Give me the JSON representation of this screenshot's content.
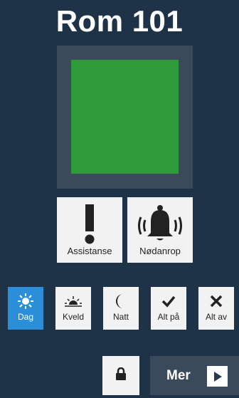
{
  "room": {
    "title": "Rom 101"
  },
  "status": {
    "color": "#2f9a3a"
  },
  "actions": {
    "assistance_label": "Assistanse",
    "assistance_icon": "exclamation-icon",
    "emergency_label": "Nødanrop",
    "emergency_icon": "alarm-bell-icon"
  },
  "modes": [
    {
      "label": "Dag",
      "icon": "sun-icon",
      "active": true
    },
    {
      "label": "Kveld",
      "icon": "sunset-icon",
      "active": false
    },
    {
      "label": "Natt",
      "icon": "moon-icon",
      "active": false
    },
    {
      "label": "Alt på",
      "icon": "checkmark-icon",
      "active": false
    },
    {
      "label": "Alt av",
      "icon": "x-icon",
      "active": false
    }
  ],
  "footer": {
    "lock_icon": "lock-icon",
    "more_label": "Mer",
    "more_icon": "play-arrow-icon"
  },
  "colors": {
    "background": "#1f3348",
    "active_mode": "#2a8fd8",
    "button": "#f2f2f2"
  }
}
